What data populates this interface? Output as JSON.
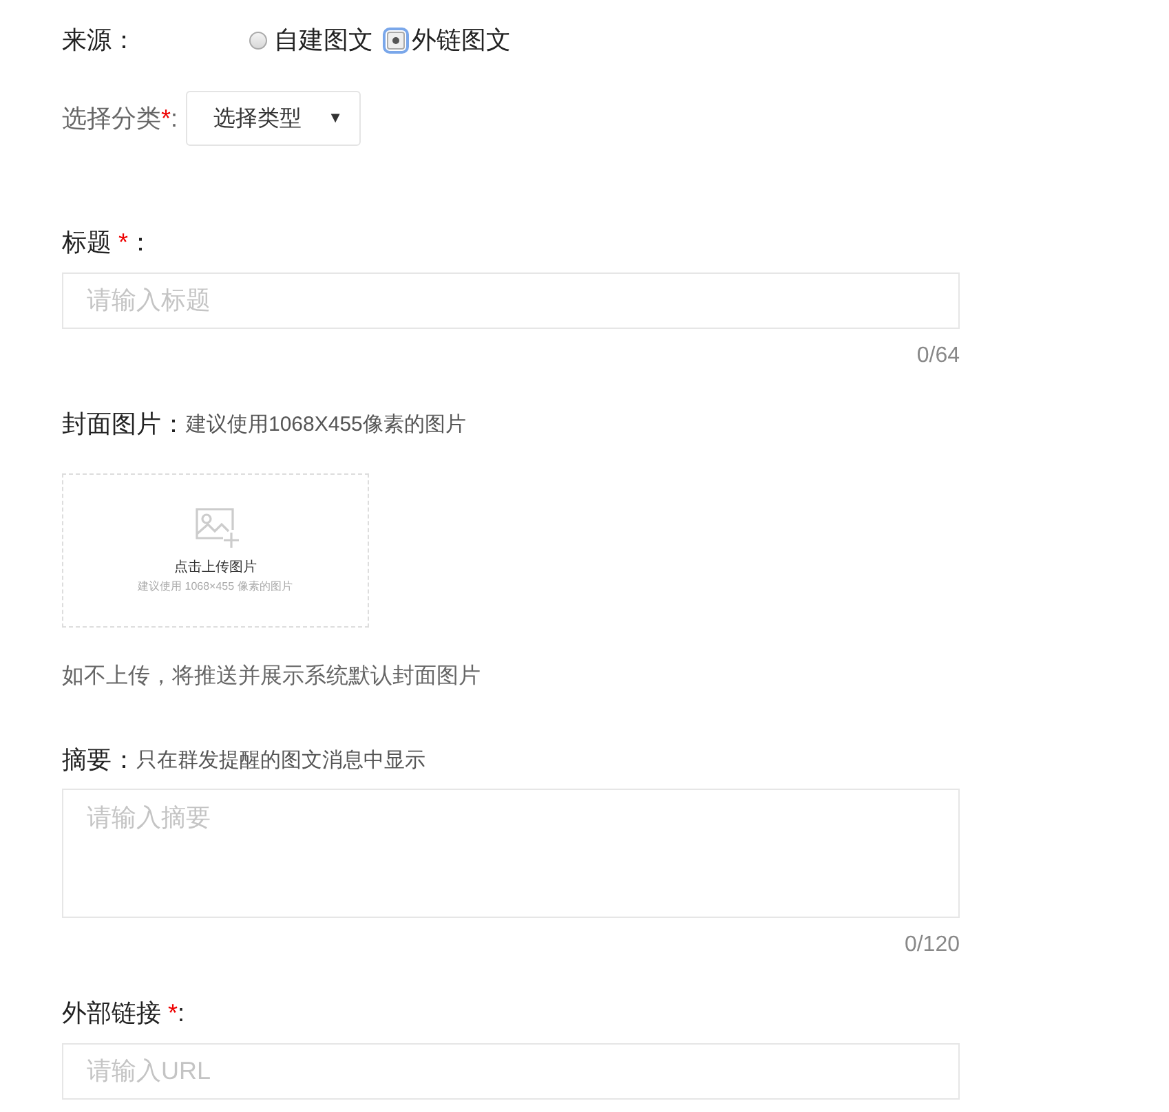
{
  "source": {
    "label": "来源：",
    "options": [
      {
        "label": "自建图文",
        "selected": false
      },
      {
        "label": "外链图文",
        "selected": true
      }
    ]
  },
  "category": {
    "label": "选择分类",
    "required": "*",
    "colon": ":",
    "select": {
      "value": "选择类型",
      "caret": "▼"
    }
  },
  "title": {
    "label": "标题 ",
    "required": "*",
    "colon": "：",
    "placeholder": "请输入标题",
    "counter": "0/64"
  },
  "cover": {
    "label": "封面图片：",
    "hint": "建议使用1068X455像素的图片",
    "upload": {
      "text": "点击上传图片",
      "hint": "建议使用 1068×455 像素的图片"
    },
    "note": "如不上传，将推送并展示系统默认封面图片"
  },
  "summary": {
    "label": "摘要：",
    "hint": "只在群发提醒的图文消息中显示",
    "placeholder": "请输入摘要",
    "counter": "0/120"
  },
  "link": {
    "label": "外部链接 ",
    "required": "*",
    "colon": ":",
    "placeholder": "请输入URL"
  }
}
